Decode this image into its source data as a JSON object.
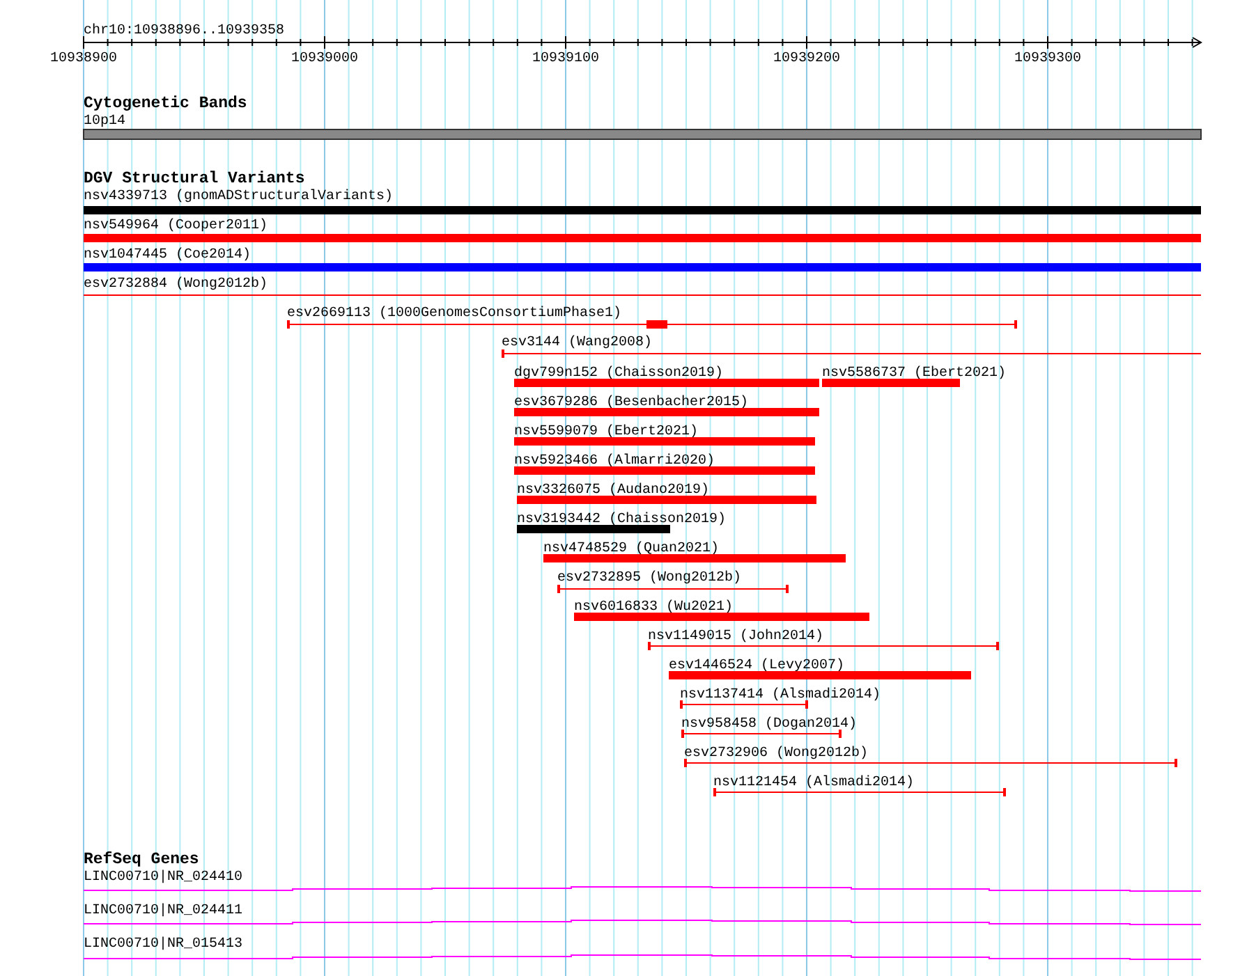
{
  "ruler": {
    "location": "chr10:10938896..10939358",
    "ticks": [
      "10938900",
      "10939000",
      "10939100",
      "10939200",
      "10939300"
    ]
  },
  "tracks": [
    {
      "title": "Cytogenetic Bands",
      "features": [
        {
          "label": "10p14",
          "kind": "band"
        }
      ]
    },
    {
      "title": "DGV Structural Variants",
      "features": [
        {
          "label": "nsv4339713 (gnomADStructuralVariants)",
          "kind": "bar",
          "color": "#000000"
        },
        {
          "label": "nsv549964 (Cooper2011)",
          "kind": "bar",
          "color": "#ff0000"
        },
        {
          "label": "nsv1047445 (Coe2014)",
          "kind": "bar",
          "color": "#0000ff"
        },
        {
          "label": "esv2732884 (Wong2012b)",
          "kind": "line",
          "color": "#ff0000"
        },
        {
          "label": "esv2669113 (1000GenomesConsortiumPhase1)",
          "kind": "line",
          "color": "#ff0000"
        },
        {
          "label": "esv3144 (Wang2008)",
          "kind": "line",
          "color": "#ff0000"
        },
        {
          "label": "dgv799n152 (Chaisson2019)",
          "kind": "bar",
          "color": "#ff0000"
        },
        {
          "label": "nsv5586737 (Ebert2021)",
          "kind": "bar",
          "color": "#ff0000"
        },
        {
          "label": "esv3679286 (Besenbacher2015)",
          "kind": "bar",
          "color": "#ff0000"
        },
        {
          "label": "nsv5599079 (Ebert2021)",
          "kind": "bar",
          "color": "#ff0000"
        },
        {
          "label": "nsv5923466 (Almarri2020)",
          "kind": "bar",
          "color": "#ff0000"
        },
        {
          "label": "nsv3326075 (Audano2019)",
          "kind": "bar",
          "color": "#ff0000"
        },
        {
          "label": "nsv3193442 (Chaisson2019)",
          "kind": "bar",
          "color": "#000000"
        },
        {
          "label": "nsv4748529 (Quan2021)",
          "kind": "bar",
          "color": "#ff0000"
        },
        {
          "label": "esv2732895 (Wong2012b)",
          "kind": "line",
          "color": "#ff0000"
        },
        {
          "label": "nsv6016833 (Wu2021)",
          "kind": "bar",
          "color": "#ff0000"
        },
        {
          "label": "nsv1149015 (John2014)",
          "kind": "line",
          "color": "#ff0000"
        },
        {
          "label": "esv1446524 (Levy2007)",
          "kind": "bar",
          "color": "#ff0000"
        },
        {
          "label": "nsv1137414 (Alsmadi2014)",
          "kind": "line",
          "color": "#ff0000"
        },
        {
          "label": "nsv958458 (Dogan2014)",
          "kind": "line",
          "color": "#ff0000"
        },
        {
          "label": "esv2732906 (Wong2012b)",
          "kind": "line",
          "color": "#ff0000"
        },
        {
          "label": "nsv1121454 (Alsmadi2014)",
          "kind": "line",
          "color": "#ff0000"
        }
      ]
    },
    {
      "title": "RefSeq Genes",
      "features": [
        {
          "label": "LINC00710|NR_024410",
          "kind": "gene"
        },
        {
          "label": "LINC00710|NR_024411",
          "kind": "gene"
        },
        {
          "label": "LINC00710|NR_015413",
          "kind": "gene"
        }
      ]
    }
  ]
}
